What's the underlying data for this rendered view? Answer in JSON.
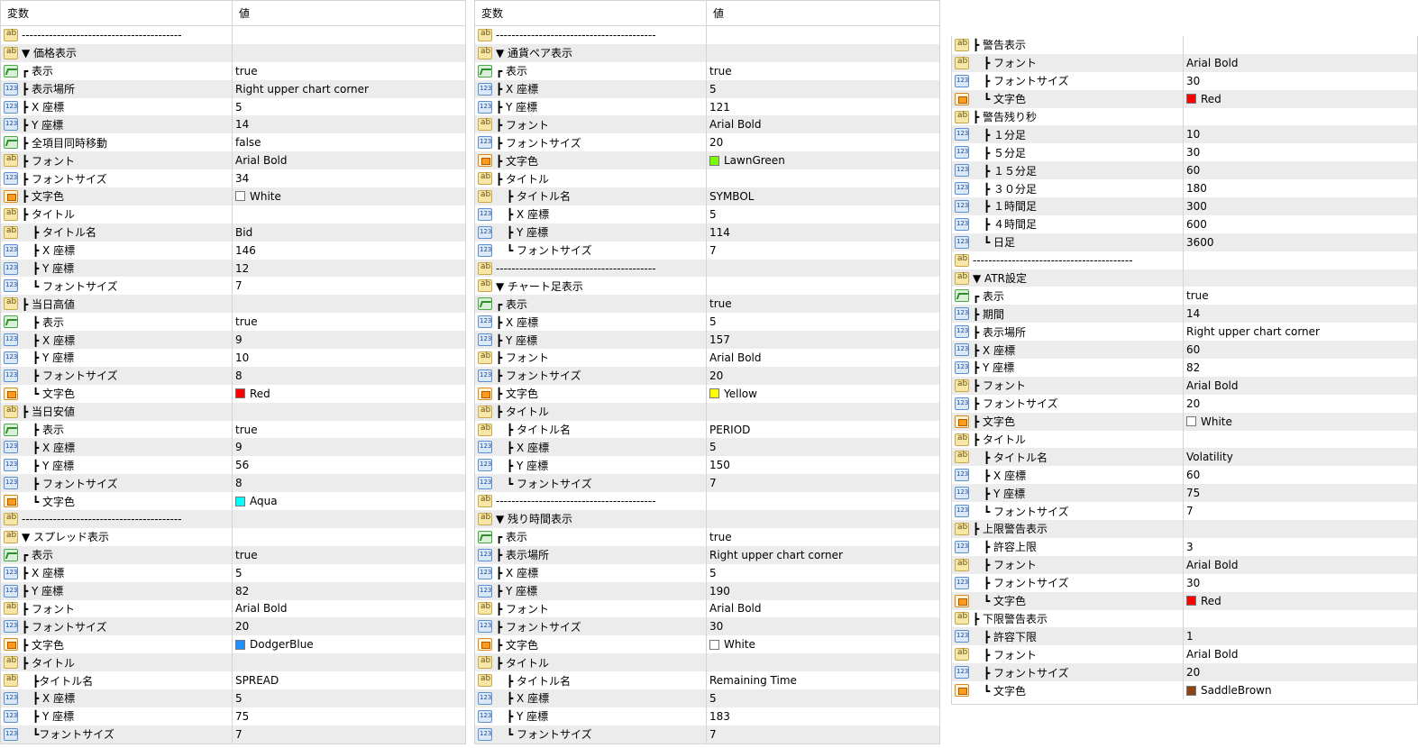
{
  "panels": [
    {
      "header": {
        "col1": "変数",
        "col2": "値"
      },
      "rows": [
        {
          "icon": "ab",
          "name": "-----------------------------------------",
          "value": ""
        },
        {
          "icon": "ab",
          "name": "▼ 価格表示",
          "value": ""
        },
        {
          "icon": "bool",
          "name": "┏ 表示",
          "value": "true"
        },
        {
          "icon": "num",
          "name": "┣ 表示場所",
          "value": "Right upper chart corner"
        },
        {
          "icon": "num",
          "name": "┣ X 座標",
          "value": "5"
        },
        {
          "icon": "num",
          "name": "┣ Y 座標",
          "value": "14"
        },
        {
          "icon": "bool",
          "name": "┣ 全項目同時移動",
          "value": "false"
        },
        {
          "icon": "ab",
          "name": "┣ フォント",
          "value": "Arial Bold"
        },
        {
          "icon": "num",
          "name": "┣ フォントサイズ",
          "value": "34"
        },
        {
          "icon": "color",
          "name": "┣ 文字色",
          "value": "White",
          "swatch": "#ffffff"
        },
        {
          "icon": "ab",
          "name": "┣ タイトル",
          "value": ""
        },
        {
          "icon": "ab",
          "name": "　┣ タイトル名",
          "value": "Bid"
        },
        {
          "icon": "num",
          "name": "　┣ X 座標",
          "value": "146"
        },
        {
          "icon": "num",
          "name": "　┣ Y 座標",
          "value": "12"
        },
        {
          "icon": "num",
          "name": "　┗ フォントサイズ",
          "value": "7"
        },
        {
          "icon": "ab",
          "name": "┣ 当日高値",
          "value": ""
        },
        {
          "icon": "bool",
          "name": "　┣ 表示",
          "value": "true"
        },
        {
          "icon": "num",
          "name": "　┣ X 座標",
          "value": "9"
        },
        {
          "icon": "num",
          "name": "　┣ Y 座標",
          "value": "10"
        },
        {
          "icon": "num",
          "name": "　┣ フォントサイズ",
          "value": "8"
        },
        {
          "icon": "color",
          "name": "　┗ 文字色",
          "value": "Red",
          "swatch": "#ff0000"
        },
        {
          "icon": "ab",
          "name": "┣ 当日安値",
          "value": ""
        },
        {
          "icon": "bool",
          "name": "　┣ 表示",
          "value": "true"
        },
        {
          "icon": "num",
          "name": "　┣ X 座標",
          "value": "9"
        },
        {
          "icon": "num",
          "name": "　┣ Y 座標",
          "value": "56"
        },
        {
          "icon": "num",
          "name": "　┣ フォントサイズ",
          "value": "8"
        },
        {
          "icon": "color",
          "name": "　┗ 文字色",
          "value": "Aqua",
          "swatch": "#00ffff"
        },
        {
          "icon": "ab",
          "name": "-----------------------------------------",
          "value": ""
        },
        {
          "icon": "ab",
          "name": "▼ スプレッド表示",
          "value": ""
        },
        {
          "icon": "bool",
          "name": "┏ 表示",
          "value": "true"
        },
        {
          "icon": "num",
          "name": "┣ X 座標",
          "value": "5"
        },
        {
          "icon": "num",
          "name": "┣ Y 座標",
          "value": "82"
        },
        {
          "icon": "ab",
          "name": "┣ フォント",
          "value": "Arial Bold"
        },
        {
          "icon": "num",
          "name": "┣ フォントサイズ",
          "value": "20"
        },
        {
          "icon": "color",
          "name": "┣ 文字色",
          "value": "DodgerBlue",
          "swatch": "#1e90ff"
        },
        {
          "icon": "ab",
          "name": "┣ タイトル",
          "value": ""
        },
        {
          "icon": "ab",
          "name": "　┣タイトル名",
          "value": "SPREAD"
        },
        {
          "icon": "num",
          "name": "　┣ X 座標",
          "value": "5"
        },
        {
          "icon": "num",
          "name": "　┣ Y 座標",
          "value": "75"
        },
        {
          "icon": "num",
          "name": "　┗フォントサイズ",
          "value": "7"
        }
      ]
    },
    {
      "header": {
        "col1": "変数",
        "col2": "値"
      },
      "rows": [
        {
          "icon": "ab",
          "name": "-----------------------------------------",
          "value": ""
        },
        {
          "icon": "ab",
          "name": "▼ 通貨ペア表示",
          "value": ""
        },
        {
          "icon": "bool",
          "name": "┏ 表示",
          "value": "true"
        },
        {
          "icon": "num",
          "name": "┣ X 座標",
          "value": "5"
        },
        {
          "icon": "num",
          "name": "┣ Y 座標",
          "value": "121"
        },
        {
          "icon": "ab",
          "name": "┣ フォント",
          "value": "Arial Bold"
        },
        {
          "icon": "num",
          "name": "┣ フォントサイズ",
          "value": "20"
        },
        {
          "icon": "color",
          "name": "┣ 文字色",
          "value": "LawnGreen",
          "swatch": "#7cfc00"
        },
        {
          "icon": "ab",
          "name": "┣ タイトル",
          "value": ""
        },
        {
          "icon": "ab",
          "name": "　┣ タイトル名",
          "value": "SYMBOL"
        },
        {
          "icon": "num",
          "name": "　┣ X 座標",
          "value": "5"
        },
        {
          "icon": "num",
          "name": "　┣ Y 座標",
          "value": "114"
        },
        {
          "icon": "num",
          "name": "　┗ フォントサイズ",
          "value": "7"
        },
        {
          "icon": "ab",
          "name": "-----------------------------------------",
          "value": ""
        },
        {
          "icon": "ab",
          "name": "▼ チャート足表示",
          "value": ""
        },
        {
          "icon": "bool",
          "name": "┏ 表示",
          "value": "true"
        },
        {
          "icon": "num",
          "name": "┣ X 座標",
          "value": "5"
        },
        {
          "icon": "num",
          "name": "┣ Y 座標",
          "value": "157"
        },
        {
          "icon": "ab",
          "name": "┣ フォント",
          "value": "Arial Bold"
        },
        {
          "icon": "num",
          "name": "┣ フォントサイズ",
          "value": "20"
        },
        {
          "icon": "color",
          "name": "┣ 文字色",
          "value": "Yellow",
          "swatch": "#ffff00"
        },
        {
          "icon": "ab",
          "name": "┣ タイトル",
          "value": ""
        },
        {
          "icon": "ab",
          "name": "　┣ タイトル名",
          "value": "PERIOD"
        },
        {
          "icon": "num",
          "name": "　┣ X 座標",
          "value": "5"
        },
        {
          "icon": "num",
          "name": "　┣ Y 座標",
          "value": "150"
        },
        {
          "icon": "num",
          "name": "　┗ フォントサイズ",
          "value": "7"
        },
        {
          "icon": "ab",
          "name": "-----------------------------------------",
          "value": ""
        },
        {
          "icon": "ab",
          "name": "▼ 残り時間表示",
          "value": ""
        },
        {
          "icon": "bool",
          "name": "┏ 表示",
          "value": "true"
        },
        {
          "icon": "num",
          "name": "┣ 表示場所",
          "value": "Right upper chart corner"
        },
        {
          "icon": "num",
          "name": "┣ X 座標",
          "value": "5"
        },
        {
          "icon": "num",
          "name": "┣ Y 座標",
          "value": "190"
        },
        {
          "icon": "ab",
          "name": "┣ フォント",
          "value": "Arial Bold"
        },
        {
          "icon": "num",
          "name": "┣ フォントサイズ",
          "value": "30"
        },
        {
          "icon": "color",
          "name": "┣ 文字色",
          "value": "White",
          "swatch": "#ffffff"
        },
        {
          "icon": "ab",
          "name": "┣ タイトル",
          "value": ""
        },
        {
          "icon": "ab",
          "name": "　┣ タイトル名",
          "value": "Remaining Time"
        },
        {
          "icon": "num",
          "name": "　┣ X 座標",
          "value": "5"
        },
        {
          "icon": "num",
          "name": "　┣ Y 座標",
          "value": "183"
        },
        {
          "icon": "num",
          "name": "　┗ フォントサイズ",
          "value": "7"
        }
      ]
    },
    {
      "rows": [
        {
          "icon": "ab",
          "name": "┣ 警告表示",
          "value": ""
        },
        {
          "icon": "ab",
          "name": "　┣ フォント",
          "value": "Arial Bold"
        },
        {
          "icon": "num",
          "name": "　┣ フォントサイズ",
          "value": "30"
        },
        {
          "icon": "color",
          "name": "　┗ 文字色",
          "value": "Red",
          "swatch": "#ff0000"
        },
        {
          "icon": "ab",
          "name": "┣ 警告残り秒",
          "value": ""
        },
        {
          "icon": "num",
          "name": "　┣ １分足",
          "value": "10"
        },
        {
          "icon": "num",
          "name": "　┣ ５分足",
          "value": "30"
        },
        {
          "icon": "num",
          "name": "　┣ １５分足",
          "value": "60"
        },
        {
          "icon": "num",
          "name": "　┣ ３０分足",
          "value": "180"
        },
        {
          "icon": "num",
          "name": "　┣ １時間足",
          "value": "300"
        },
        {
          "icon": "num",
          "name": "　┣ ４時間足",
          "value": "600"
        },
        {
          "icon": "num",
          "name": "　┗ 日足",
          "value": "3600"
        },
        {
          "icon": "ab",
          "name": "-----------------------------------------",
          "value": ""
        },
        {
          "icon": "ab",
          "name": "▼ ATR設定",
          "value": ""
        },
        {
          "icon": "bool",
          "name": "┏ 表示",
          "value": "true"
        },
        {
          "icon": "num",
          "name": "┣ 期間",
          "value": "14"
        },
        {
          "icon": "num",
          "name": "┣ 表示場所",
          "value": "Right upper chart corner"
        },
        {
          "icon": "num",
          "name": "┣ X 座標",
          "value": "60"
        },
        {
          "icon": "num",
          "name": "┣ Y 座標",
          "value": "82"
        },
        {
          "icon": "ab",
          "name": "┣ フォント",
          "value": "Arial Bold"
        },
        {
          "icon": "num",
          "name": "┣ フォントサイズ",
          "value": "20"
        },
        {
          "icon": "color",
          "name": "┣ 文字色",
          "value": "White",
          "swatch": "#ffffff"
        },
        {
          "icon": "ab",
          "name": "┣ タイトル",
          "value": ""
        },
        {
          "icon": "ab",
          "name": "　┣ タイトル名",
          "value": "Volatility"
        },
        {
          "icon": "num",
          "name": "　┣ X 座標",
          "value": "60"
        },
        {
          "icon": "num",
          "name": "　┣ Y 座標",
          "value": "75"
        },
        {
          "icon": "num",
          "name": "　┗ フォントサイズ",
          "value": "7"
        },
        {
          "icon": "ab",
          "name": "┣ 上限警告表示",
          "value": ""
        },
        {
          "icon": "num",
          "name": "　┣ 許容上限",
          "value": "3"
        },
        {
          "icon": "ab",
          "name": "　┣ フォント",
          "value": "Arial Bold"
        },
        {
          "icon": "num",
          "name": "　┣ フォントサイズ",
          "value": "30"
        },
        {
          "icon": "color",
          "name": "　┗ 文字色",
          "value": "Red",
          "swatch": "#ff0000"
        },
        {
          "icon": "ab",
          "name": "┣ 下限警告表示",
          "value": ""
        },
        {
          "icon": "num",
          "name": "　┣ 許容下限",
          "value": "1"
        },
        {
          "icon": "ab",
          "name": "　┣ フォント",
          "value": "Arial Bold"
        },
        {
          "icon": "num",
          "name": "　┣ フォントサイズ",
          "value": "20"
        },
        {
          "icon": "color",
          "name": "　┗ 文字色",
          "value": "SaddleBrown",
          "swatch": "#8b4513"
        }
      ]
    }
  ]
}
